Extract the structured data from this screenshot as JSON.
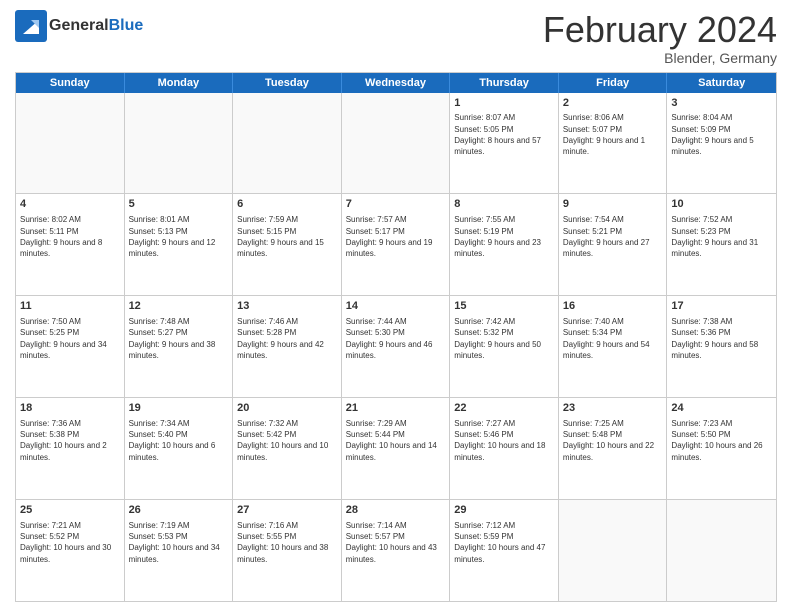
{
  "header": {
    "logo": {
      "general": "General",
      "blue": "Blue"
    },
    "title": "February 2024",
    "subtitle": "Blender, Germany"
  },
  "weekdays": [
    "Sunday",
    "Monday",
    "Tuesday",
    "Wednesday",
    "Thursday",
    "Friday",
    "Saturday"
  ],
  "weeks": [
    [
      {
        "day": "",
        "info": ""
      },
      {
        "day": "",
        "info": ""
      },
      {
        "day": "",
        "info": ""
      },
      {
        "day": "",
        "info": ""
      },
      {
        "day": "1",
        "info": "Sunrise: 8:07 AM\nSunset: 5:05 PM\nDaylight: 8 hours and 57 minutes."
      },
      {
        "day": "2",
        "info": "Sunrise: 8:06 AM\nSunset: 5:07 PM\nDaylight: 9 hours and 1 minute."
      },
      {
        "day": "3",
        "info": "Sunrise: 8:04 AM\nSunset: 5:09 PM\nDaylight: 9 hours and 5 minutes."
      }
    ],
    [
      {
        "day": "4",
        "info": "Sunrise: 8:02 AM\nSunset: 5:11 PM\nDaylight: 9 hours and 8 minutes."
      },
      {
        "day": "5",
        "info": "Sunrise: 8:01 AM\nSunset: 5:13 PM\nDaylight: 9 hours and 12 minutes."
      },
      {
        "day": "6",
        "info": "Sunrise: 7:59 AM\nSunset: 5:15 PM\nDaylight: 9 hours and 15 minutes."
      },
      {
        "day": "7",
        "info": "Sunrise: 7:57 AM\nSunset: 5:17 PM\nDaylight: 9 hours and 19 minutes."
      },
      {
        "day": "8",
        "info": "Sunrise: 7:55 AM\nSunset: 5:19 PM\nDaylight: 9 hours and 23 minutes."
      },
      {
        "day": "9",
        "info": "Sunrise: 7:54 AM\nSunset: 5:21 PM\nDaylight: 9 hours and 27 minutes."
      },
      {
        "day": "10",
        "info": "Sunrise: 7:52 AM\nSunset: 5:23 PM\nDaylight: 9 hours and 31 minutes."
      }
    ],
    [
      {
        "day": "11",
        "info": "Sunrise: 7:50 AM\nSunset: 5:25 PM\nDaylight: 9 hours and 34 minutes."
      },
      {
        "day": "12",
        "info": "Sunrise: 7:48 AM\nSunset: 5:27 PM\nDaylight: 9 hours and 38 minutes."
      },
      {
        "day": "13",
        "info": "Sunrise: 7:46 AM\nSunset: 5:28 PM\nDaylight: 9 hours and 42 minutes."
      },
      {
        "day": "14",
        "info": "Sunrise: 7:44 AM\nSunset: 5:30 PM\nDaylight: 9 hours and 46 minutes."
      },
      {
        "day": "15",
        "info": "Sunrise: 7:42 AM\nSunset: 5:32 PM\nDaylight: 9 hours and 50 minutes."
      },
      {
        "day": "16",
        "info": "Sunrise: 7:40 AM\nSunset: 5:34 PM\nDaylight: 9 hours and 54 minutes."
      },
      {
        "day": "17",
        "info": "Sunrise: 7:38 AM\nSunset: 5:36 PM\nDaylight: 9 hours and 58 minutes."
      }
    ],
    [
      {
        "day": "18",
        "info": "Sunrise: 7:36 AM\nSunset: 5:38 PM\nDaylight: 10 hours and 2 minutes."
      },
      {
        "day": "19",
        "info": "Sunrise: 7:34 AM\nSunset: 5:40 PM\nDaylight: 10 hours and 6 minutes."
      },
      {
        "day": "20",
        "info": "Sunrise: 7:32 AM\nSunset: 5:42 PM\nDaylight: 10 hours and 10 minutes."
      },
      {
        "day": "21",
        "info": "Sunrise: 7:29 AM\nSunset: 5:44 PM\nDaylight: 10 hours and 14 minutes."
      },
      {
        "day": "22",
        "info": "Sunrise: 7:27 AM\nSunset: 5:46 PM\nDaylight: 10 hours and 18 minutes."
      },
      {
        "day": "23",
        "info": "Sunrise: 7:25 AM\nSunset: 5:48 PM\nDaylight: 10 hours and 22 minutes."
      },
      {
        "day": "24",
        "info": "Sunrise: 7:23 AM\nSunset: 5:50 PM\nDaylight: 10 hours and 26 minutes."
      }
    ],
    [
      {
        "day": "25",
        "info": "Sunrise: 7:21 AM\nSunset: 5:52 PM\nDaylight: 10 hours and 30 minutes."
      },
      {
        "day": "26",
        "info": "Sunrise: 7:19 AM\nSunset: 5:53 PM\nDaylight: 10 hours and 34 minutes."
      },
      {
        "day": "27",
        "info": "Sunrise: 7:16 AM\nSunset: 5:55 PM\nDaylight: 10 hours and 38 minutes."
      },
      {
        "day": "28",
        "info": "Sunrise: 7:14 AM\nSunset: 5:57 PM\nDaylight: 10 hours and 43 minutes."
      },
      {
        "day": "29",
        "info": "Sunrise: 7:12 AM\nSunset: 5:59 PM\nDaylight: 10 hours and 47 minutes."
      },
      {
        "day": "",
        "info": ""
      },
      {
        "day": "",
        "info": ""
      }
    ]
  ]
}
